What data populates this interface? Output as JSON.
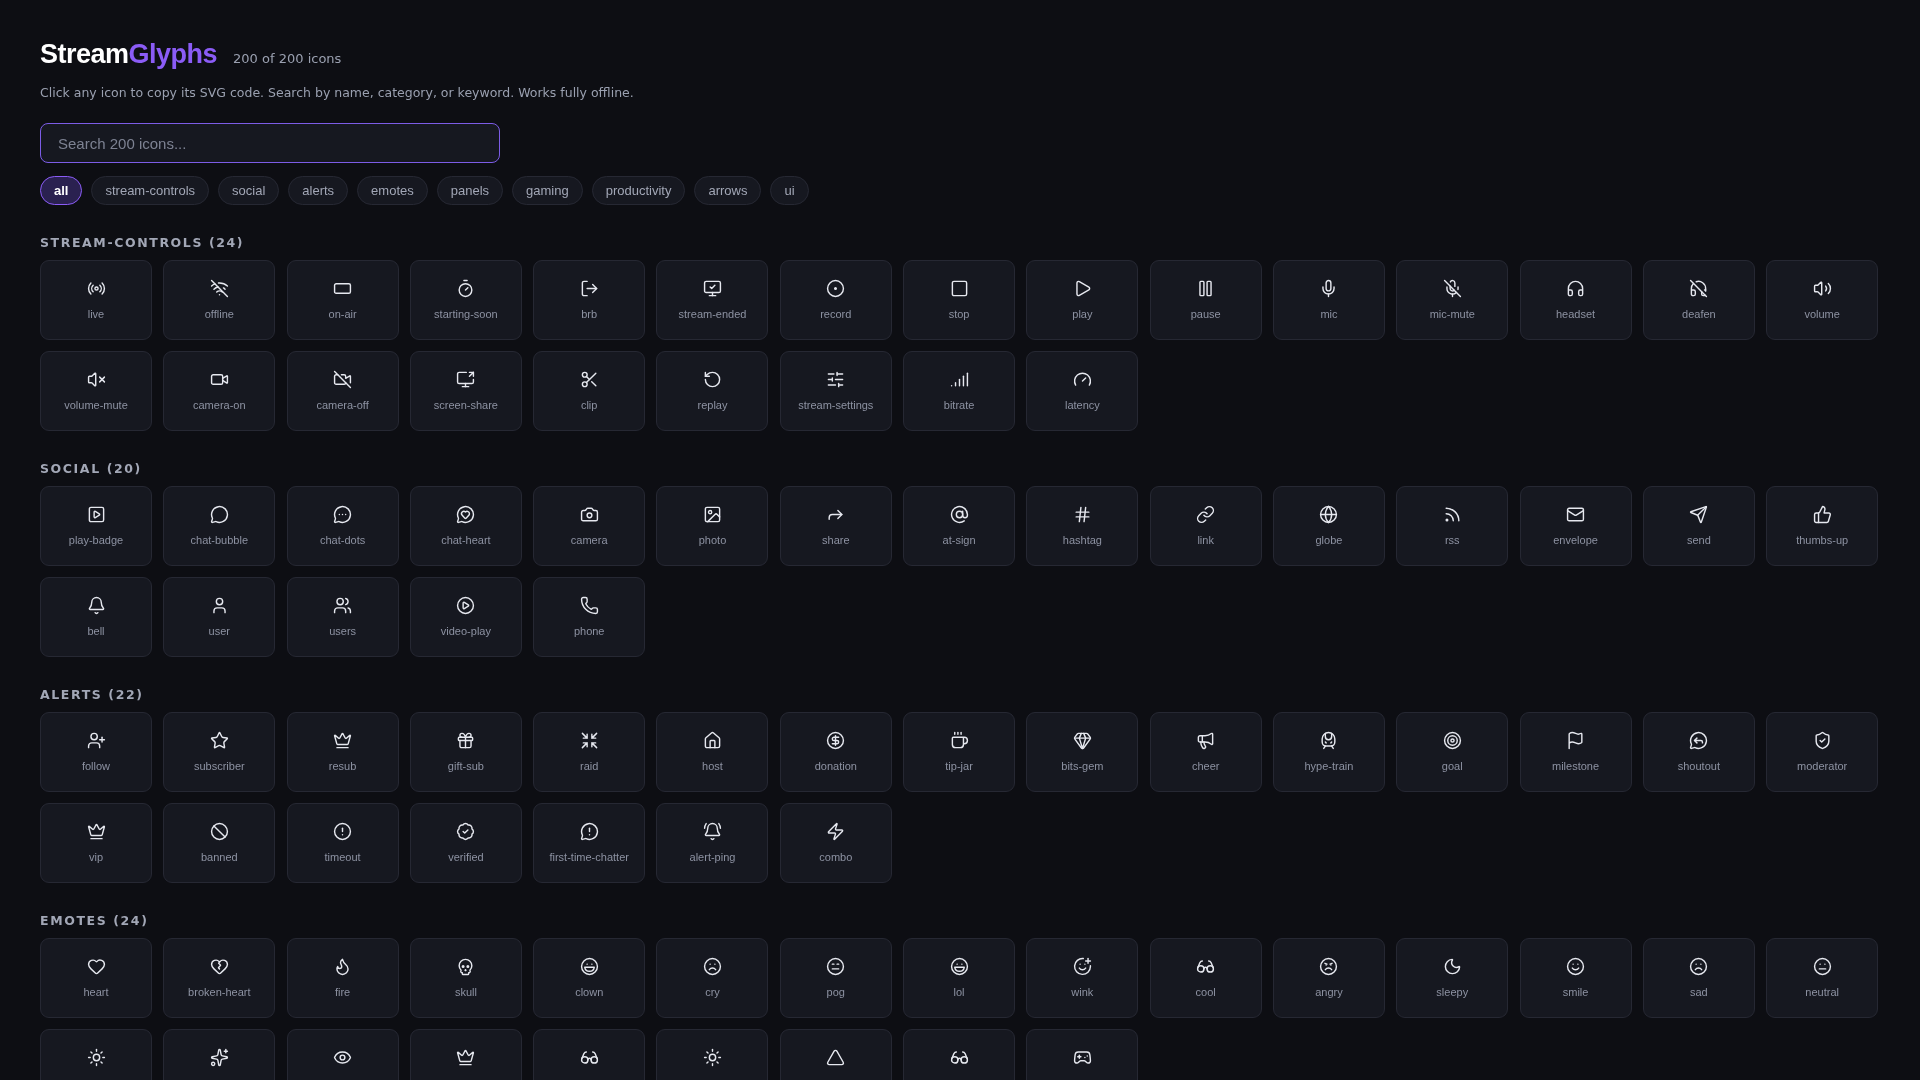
{
  "header": {
    "brand_main": "Stream",
    "brand_accent": "Glyphs",
    "count": "200 of 200 icons",
    "description": "Click any icon to copy its SVG code. Search by name, category, or keyword. Works fully offline."
  },
  "search": {
    "placeholder": "Search 200 icons..."
  },
  "categories": [
    {
      "label": "all",
      "selected": true
    },
    {
      "label": "stream-controls",
      "selected": false
    },
    {
      "label": "social",
      "selected": false
    },
    {
      "label": "alerts",
      "selected": false
    },
    {
      "label": "emotes",
      "selected": false
    },
    {
      "label": "panels",
      "selected": false
    },
    {
      "label": "gaming",
      "selected": false
    },
    {
      "label": "productivity",
      "selected": false
    },
    {
      "label": "arrows",
      "selected": false
    },
    {
      "label": "ui",
      "selected": false
    }
  ],
  "sections": [
    {
      "title": "STREAM-CONTROLS (24)",
      "icons": [
        {
          "kind": "labeled",
          "label": "live"
        },
        {
          "kind": "labeled",
          "label": "offline"
        },
        {
          "kind": "labeled",
          "label": "on-air"
        },
        {
          "kind": "labeled",
          "label": "starting-soon"
        },
        {
          "kind": "labeled",
          "label": "brb"
        },
        {
          "kind": "labeled",
          "label": "stream-ended"
        },
        {
          "kind": "labeled",
          "label": "record"
        },
        {
          "kind": "labeled",
          "label": "stop"
        },
        {
          "kind": "labeled",
          "label": "play"
        },
        {
          "kind": "labeled",
          "label": "pause"
        },
        {
          "kind": "labeled",
          "label": "mic"
        },
        {
          "kind": "labeled",
          "label": "mic-mute"
        },
        {
          "kind": "labeled",
          "label": "headset"
        },
        {
          "kind": "labeled",
          "label": "deafen"
        },
        {
          "kind": "labeled",
          "label": "volume"
        },
        {
          "kind": "labeled",
          "label": "volume-mute"
        },
        {
          "kind": "labeled",
          "label": "camera-on"
        },
        {
          "kind": "labeled",
          "label": "camera-off"
        },
        {
          "kind": "labeled",
          "label": "screen-share"
        },
        {
          "kind": "labeled",
          "label": "clip"
        },
        {
          "kind": "labeled",
          "label": "replay"
        },
        {
          "kind": "labeled",
          "label": "stream-settings"
        },
        {
          "kind": "labeled",
          "label": "bitrate"
        },
        {
          "kind": "labeled",
          "label": "latency"
        }
      ]
    },
    {
      "title": "SOCIAL (20)",
      "icons": [
        {
          "kind": "labeled",
          "label": "play-badge"
        },
        {
          "kind": "labeled",
          "label": "chat-bubble"
        },
        {
          "kind": "labeled",
          "label": "chat-dots"
        },
        {
          "kind": "labeled",
          "label": "chat-heart"
        },
        {
          "kind": "labeled",
          "label": "camera"
        },
        {
          "kind": "labeled",
          "label": "photo"
        },
        {
          "kind": "labeled",
          "label": "share"
        },
        {
          "kind": "labeled",
          "label": "at-sign"
        },
        {
          "kind": "labeled",
          "label": "hashtag"
        },
        {
          "kind": "labeled",
          "label": "link"
        },
        {
          "kind": "labeled",
          "label": "globe"
        },
        {
          "kind": "labeled",
          "label": "rss"
        },
        {
          "kind": "labeled",
          "label": "envelope"
        },
        {
          "kind": "labeled",
          "label": "send"
        },
        {
          "kind": "labeled",
          "label": "thumbs-up"
        },
        {
          "kind": "labeled",
          "label": "bell"
        },
        {
          "kind": "labeled",
          "label": "user"
        },
        {
          "kind": "labeled",
          "label": "users"
        },
        {
          "kind": "labeled",
          "label": "video-play"
        },
        {
          "kind": "labeled",
          "label": "phone"
        }
      ]
    },
    {
      "title": "ALERTS (22)",
      "icons": [
        {
          "kind": "labeled",
          "label": "follow"
        },
        {
          "kind": "labeled",
          "label": "subscriber"
        },
        {
          "kind": "labeled",
          "label": "resub"
        },
        {
          "kind": "labeled",
          "label": "gift-sub"
        },
        {
          "kind": "labeled",
          "label": "raid"
        },
        {
          "kind": "labeled",
          "label": "host"
        },
        {
          "kind": "labeled",
          "label": "donation"
        },
        {
          "kind": "labeled",
          "label": "tip-jar"
        },
        {
          "kind": "labeled",
          "label": "bits-gem"
        },
        {
          "kind": "labeled",
          "label": "cheer"
        },
        {
          "kind": "labeled",
          "label": "hype-train"
        },
        {
          "kind": "labeled",
          "label": "goal"
        },
        {
          "kind": "labeled",
          "label": "milestone"
        },
        {
          "kind": "labeled",
          "label": "shoutout"
        },
        {
          "kind": "labeled",
          "label": "moderator"
        },
        {
          "kind": "labeled",
          "label": "vip"
        },
        {
          "kind": "labeled",
          "label": "banned"
        },
        {
          "kind": "labeled",
          "label": "timeout"
        },
        {
          "kind": "labeled",
          "label": "verified"
        },
        {
          "kind": "labeled",
          "label": "first-time-chatter"
        },
        {
          "kind": "labeled",
          "label": "alert-ping"
        },
        {
          "kind": "labeled",
          "label": "combo"
        }
      ]
    },
    {
      "title": "EMOTES (24)",
      "icons": [
        {
          "kind": "labeled",
          "label": "heart"
        },
        {
          "kind": "labeled",
          "label": "broken-heart"
        },
        {
          "kind": "labeled",
          "label": "fire"
        },
        {
          "kind": "labeled",
          "label": "skull"
        },
        {
          "kind": "labeled",
          "label": "clown"
        },
        {
          "kind": "labeled",
          "label": "cry"
        },
        {
          "kind": "labeled",
          "label": "pog"
        },
        {
          "kind": "labeled",
          "label": "lol"
        },
        {
          "kind": "labeled",
          "label": "wink"
        },
        {
          "kind": "labeled",
          "label": "cool"
        },
        {
          "kind": "labeled",
          "label": "angry"
        },
        {
          "kind": "labeled",
          "label": "sleepy"
        },
        {
          "kind": "labeled",
          "label": "smile"
        },
        {
          "kind": "labeled",
          "label": "sad"
        },
        {
          "kind": "labeled",
          "label": "neutral"
        },
        {
          "kind": "cut"
        },
        {
          "kind": "cut"
        },
        {
          "kind": "cut"
        },
        {
          "kind": "cut"
        },
        {
          "kind": "cut"
        },
        {
          "kind": "cut"
        },
        {
          "kind": "cut"
        },
        {
          "kind": "cut"
        },
        {
          "kind": "cut"
        }
      ]
    }
  ]
}
